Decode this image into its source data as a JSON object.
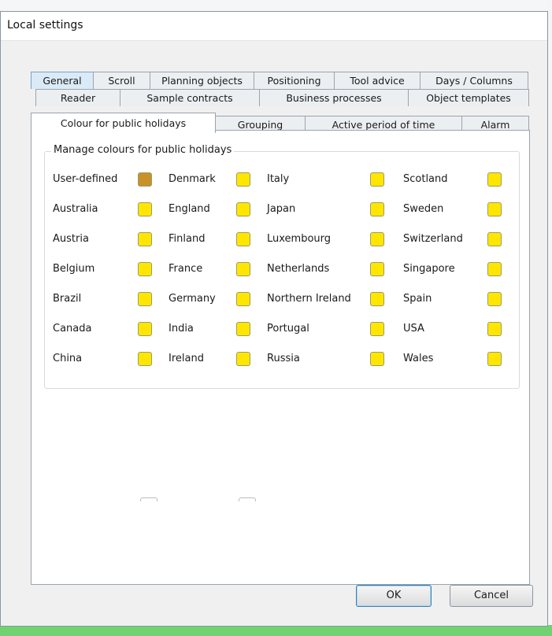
{
  "window": {
    "title": "Local settings"
  },
  "tabs": {
    "row1": [
      "General",
      "Scroll",
      "Planning objects",
      "Positioning",
      "Tool advice",
      "Days / Columns"
    ],
    "row2": [
      "Reader",
      "Sample contracts",
      "Business processes",
      "Object templates"
    ],
    "row3": [
      "Colour for public holidays",
      "Grouping",
      "Active period of time",
      "Alarm"
    ],
    "selected": "Colour for public holidays"
  },
  "group": {
    "label": "Manage colours for public holidays",
    "columns": [
      [
        {
          "name": "User-defined",
          "color": "#c8912a"
        },
        {
          "name": "Australia",
          "color": "#ffe600"
        },
        {
          "name": "Austria",
          "color": "#ffe600"
        },
        {
          "name": "Belgium",
          "color": "#ffe600"
        },
        {
          "name": "Brazil",
          "color": "#ffe600"
        },
        {
          "name": "Canada",
          "color": "#ffe600"
        },
        {
          "name": "China",
          "color": "#ffe600"
        }
      ],
      [
        {
          "name": "Denmark",
          "color": "#ffe600"
        },
        {
          "name": "England",
          "color": "#ffe600"
        },
        {
          "name": "Finland",
          "color": "#ffe600"
        },
        {
          "name": "France",
          "color": "#ffe600"
        },
        {
          "name": "Germany",
          "color": "#ffe600"
        },
        {
          "name": "India",
          "color": "#ffe600"
        },
        {
          "name": "Ireland",
          "color": "#ffe600"
        }
      ],
      [
        {
          "name": "Italy",
          "color": "#ffe600"
        },
        {
          "name": "Japan",
          "color": "#ffe600"
        },
        {
          "name": "Luxembourg",
          "color": "#ffe600"
        },
        {
          "name": "Netherlands",
          "color": "#ffe600"
        },
        {
          "name": "Northern Ireland",
          "color": "#ffe600"
        },
        {
          "name": "Portugal",
          "color": "#ffe600"
        },
        {
          "name": "Russia",
          "color": "#ffe600"
        }
      ],
      [
        {
          "name": "Scotland",
          "color": "#ffe600"
        },
        {
          "name": "Sweden",
          "color": "#ffe600"
        },
        {
          "name": "Switzerland",
          "color": "#ffe600"
        },
        {
          "name": "Singapore",
          "color": "#ffe600"
        },
        {
          "name": "Spain",
          "color": "#ffe600"
        },
        {
          "name": "USA",
          "color": "#ffe600"
        },
        {
          "name": "Wales",
          "color": "#ffe600"
        }
      ]
    ]
  },
  "buttons": {
    "ok": "OK",
    "cancel": "Cancel"
  }
}
